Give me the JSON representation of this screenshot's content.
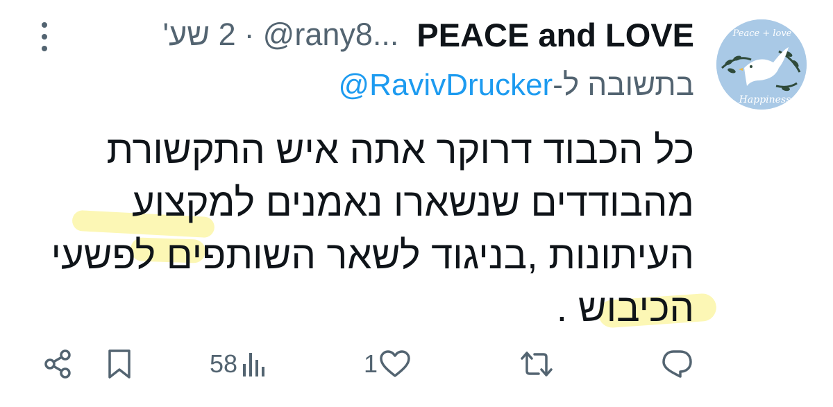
{
  "tweet": {
    "author": {
      "display_name": "PEACE and LOVE",
      "handle": "@rany8...",
      "avatar_text_top": "Peace + love",
      "avatar_text_bottom": "Happiness"
    },
    "separator": "·",
    "time": "2 שע'",
    "reply": {
      "prefix": "בתשובה ל-",
      "mention": "@RavivDrucker"
    },
    "body_lines": [
      "כל הכבוד דרוקר אתה איש התקשורת",
      "מהבודדים שנשארו נאמנים למקצוע",
      "העיתונות ,בניגוד לשאר השותפים לפשעי",
      "הכיבוש ."
    ]
  },
  "actions": {
    "views_count": "58",
    "likes_count": "1",
    "share_icon": "share-icon",
    "bookmark_icon": "bookmark-icon",
    "views_icon": "views-icon",
    "like_icon": "heart-icon",
    "retweet_icon": "retweet-icon",
    "reply_icon": "reply-icon"
  },
  "colors": {
    "text_primary": "#0f1419",
    "text_secondary": "#536471",
    "link_blue": "#1d9bf0",
    "highlighter": "#faf078",
    "avatar_bg": "#a9c9e6"
  }
}
